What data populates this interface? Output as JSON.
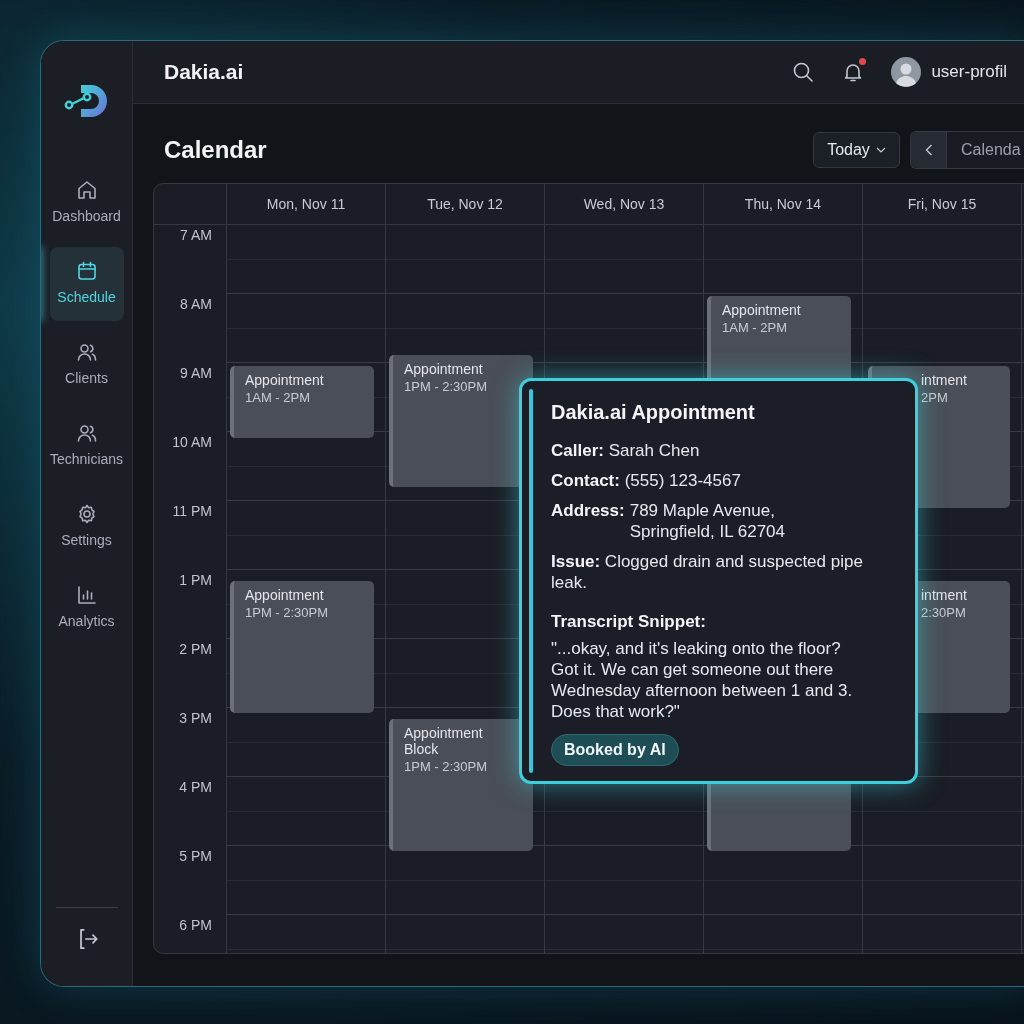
{
  "sidebar": {
    "items": [
      {
        "label": "Dashboard",
        "selected": false
      },
      {
        "label": "Schedule",
        "selected": true
      },
      {
        "label": "Clients",
        "selected": false
      },
      {
        "label": "Technicians",
        "selected": false
      },
      {
        "label": "Settings",
        "selected": false
      },
      {
        "label": "Analytics",
        "selected": false
      }
    ]
  },
  "header": {
    "title": "Dakia.ai",
    "notifications_unread": true,
    "user_name": "user-profil"
  },
  "page": {
    "title": "Calendar",
    "today_button": "Today",
    "view_label": "Calenda"
  },
  "calendar": {
    "hours": [
      "7 AM",
      "8 AM",
      "9 AM",
      "10 AM",
      "11 PM",
      "1 PM",
      "2 PM",
      "3 PM",
      "4 PM",
      "5 PM",
      "6 PM"
    ],
    "days": [
      {
        "label": "Mon, Nov 11",
        "events": [
          {
            "kind": "full",
            "title": "Appointment",
            "time": "1AM - 2PM"
          },
          {
            "kind": "full",
            "title": "Appointment",
            "time": "1PM - 2:30PM"
          }
        ]
      },
      {
        "label": "Tue, Nov 12",
        "events": [
          {
            "kind": "full",
            "title": "Appointment",
            "time": "1PM - 2:30PM"
          },
          {
            "kind": "full",
            "title": "Appointment Block",
            "time": "1PM - 2:30PM"
          }
        ]
      },
      {
        "label": "Wed, Nov 13"
      },
      {
        "label": "Thu, Nov 14",
        "events": [
          {
            "kind": "full",
            "title": "Appointment",
            "time": "1AM - 2PM"
          },
          {
            "kind": "block"
          }
        ]
      },
      {
        "label": "Fri, Nov 15",
        "events": [
          {
            "kind": "clipped",
            "title": "intment",
            "time": "2PM"
          },
          {
            "kind": "clipped",
            "title": "intment",
            "time": "2:30PM"
          }
        ]
      }
    ]
  },
  "popup": {
    "title": "Dakia.ai Appointment",
    "caller": "**Caller:** Sarah Chen",
    "contact": "**Contact:** (555) 123-4567",
    "address_label": "Address:",
    "address": "789 Maple Avenue, Springfield, IL 62704",
    "issue": "**Issue:** Clogged drain and suspected pipe leak.",
    "transcript_heading": "Transcript Snippet:",
    "transcript": "\"...okay, and it's leaking onto the floor? Got it. We can get someone out there Wednesday afternoon between 1 and 3. Does that work?\"",
    "badge": "Booked by AI"
  }
}
